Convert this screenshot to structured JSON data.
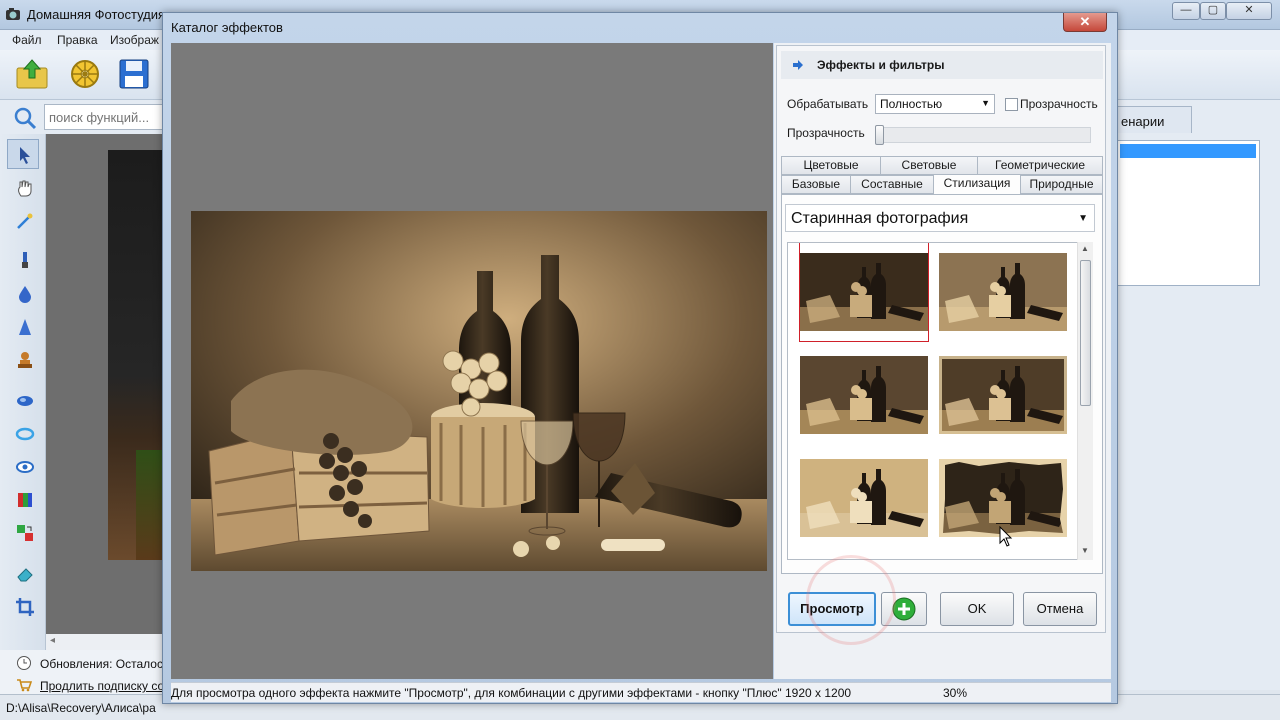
{
  "app": {
    "title": "Домашняя Фотостудия",
    "menu": [
      "Файл",
      "Правка",
      "Изображ"
    ],
    "search_placeholder": "поиск функций...",
    "scenarios_tab": "енарии",
    "status_updates": "Обновления: Осталось",
    "status_subscribe": "Продлить подписку со",
    "path": "D:\\Alisa\\Recovery\\Алиса\\ра",
    "window_buttons": [
      "—",
      "▢",
      "✕"
    ]
  },
  "dialog": {
    "title": "Каталог эффектов",
    "close_label": "✕",
    "panel_title": "Эффекты и фильтры",
    "process_label": "Обрабатывать",
    "process_value": "Полностью",
    "transparency_check_label": "Прозрачность",
    "transparency_slider_label": "Прозрачность",
    "transparency_value": 0,
    "tabs_row1": [
      "Цветовые",
      "Световые",
      "Геометрические"
    ],
    "tabs_row2": [
      "Базовые",
      "Составные",
      "Стилизация",
      "Природные"
    ],
    "active_tab": "Стилизация",
    "category": "Старинная фотография",
    "thumbnails": [
      {
        "style": "sepia-dark",
        "selected": true
      },
      {
        "style": "sepia-scratched",
        "selected": false
      },
      {
        "style": "sepia-vignette",
        "selected": false
      },
      {
        "style": "sepia-burnt",
        "selected": false
      },
      {
        "style": "sepia-faded",
        "selected": false
      },
      {
        "style": "sepia-torn",
        "selected": false
      }
    ],
    "buttons": {
      "preview": "Просмотр",
      "add": "+",
      "ok": "OK",
      "cancel": "Отмена"
    },
    "status_hint": "Для просмотра одного эффекта нажмите \"Просмотр\", для комбинации с другими эффектами - кнопку \"Плюс\"  1920 x 1200",
    "zoom": "30%"
  },
  "colors": {
    "sepia_light": "#d8b98a",
    "sepia_dark": "#3a2a18",
    "accent_red": "#d0202a",
    "selection_blue": "#3399ff"
  }
}
